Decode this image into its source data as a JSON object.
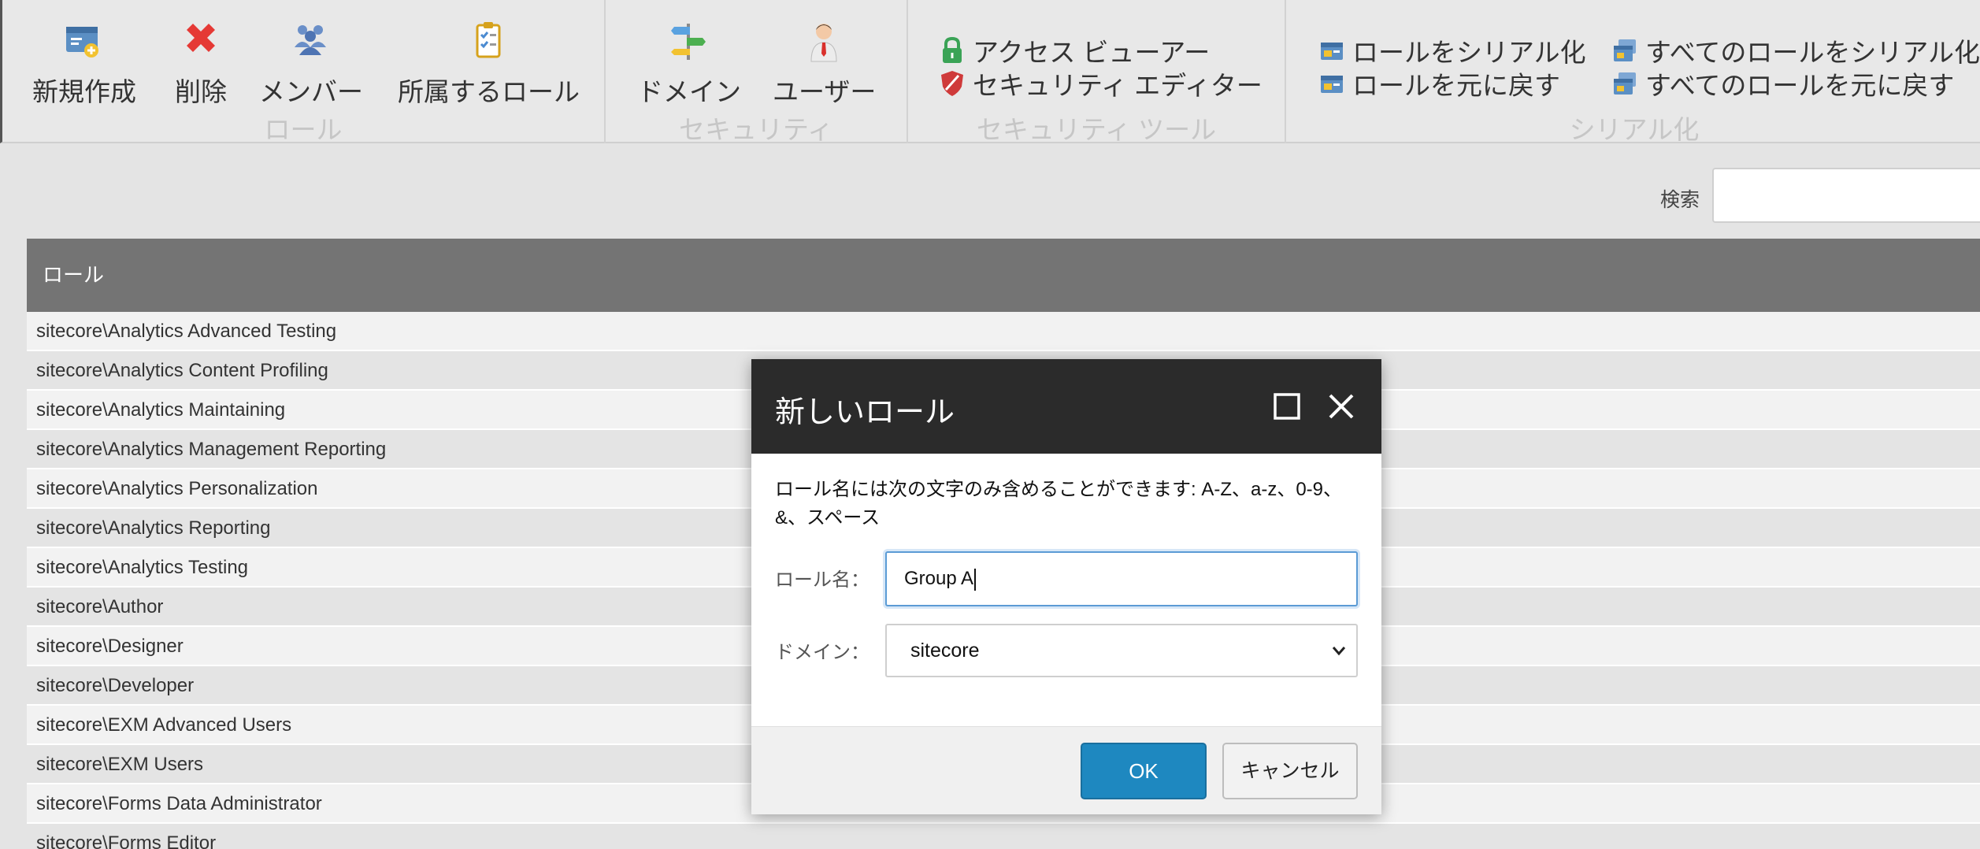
{
  "ribbon": {
    "groups": {
      "role": {
        "title": "ロール",
        "new_label": "新規作成",
        "delete_label": "削除",
        "members_label": "メンバー",
        "member_of_label": "所属するロール"
      },
      "security": {
        "title": "セキュリティ",
        "domain_label": "ドメイン",
        "user_label": "ユーザー"
      },
      "security_tools": {
        "title": "セキュリティ ツール",
        "access_viewer_label": "アクセス ビューアー",
        "security_editor_label": "セキュリティ エディター"
      },
      "serialization": {
        "title": "シリアル化",
        "serialize_role_label": "ロールをシリアル化",
        "revert_role_label": "ロールを元に戻す",
        "serialize_all_label": "すべてのロールをシリアル化",
        "revert_all_label": "すべてのロールを元に戻す"
      }
    }
  },
  "search": {
    "label": "検索",
    "value": ""
  },
  "grid": {
    "header": "ロール",
    "rows": [
      "sitecore\\Analytics Advanced Testing",
      "sitecore\\Analytics Content Profiling",
      "sitecore\\Analytics Maintaining",
      "sitecore\\Analytics Management Reporting",
      "sitecore\\Analytics Personalization",
      "sitecore\\Analytics Reporting",
      "sitecore\\Analytics Testing",
      "sitecore\\Author",
      "sitecore\\Designer",
      "sitecore\\Developer",
      "sitecore\\EXM Advanced Users",
      "sitecore\\EXM Users",
      "sitecore\\Forms Data Administrator",
      "sitecore\\Forms Editor"
    ]
  },
  "dialog": {
    "title": "新しいロール",
    "message": "ロール名には次の文字のみ含めることができます: A-Z、a-z、0-9、&、スペース",
    "name_label": "ロール名：",
    "name_value": "Group A",
    "domain_label": "ドメイン：",
    "domain_value": "sitecore",
    "ok_label": "OK",
    "cancel_label": "キャンセル"
  },
  "colors": {
    "ok_button": "#1e88c0",
    "dialog_header": "#2b2b2b",
    "grid_header": "#747474",
    "delete_icon": "#e53935",
    "lock_icon": "#3aa356"
  },
  "icons": [
    "new-role-icon",
    "delete-x-icon",
    "members-icon",
    "clipboard-check-icon",
    "domain-signpost-icon",
    "user-icon",
    "lock-icon",
    "shield-icon",
    "serialize-icon",
    "maximize-icon",
    "close-icon",
    "chevron-down-icon"
  ]
}
